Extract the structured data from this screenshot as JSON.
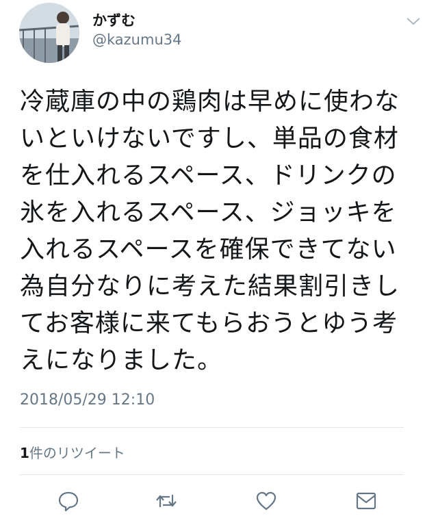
{
  "user": {
    "display_name": "かずむ",
    "handle": "@kazumu34"
  },
  "tweet": {
    "text": "冷蔵庫の中の鶏肉は早めに使わないといけないですし、単品の食材を仕入れるスペース、ドリンクの氷を入れるスペース、ジョッキを入れるスペースを確保できてない為自分なりに考えた結果割引きしてお客様に来てもらおうとゆう考えになりました。",
    "timestamp": "2018/05/29 12:10"
  },
  "stats": {
    "retweet_count": "1",
    "retweet_label": "件のリツイート"
  },
  "icons": {
    "avatar": "avatar",
    "menu": "chevron-down-icon",
    "reply": "reply-icon",
    "retweet": "retweet-icon",
    "like": "heart-icon",
    "message": "envelope-icon"
  },
  "colors": {
    "text": "#14171a",
    "secondary": "#657786",
    "divider": "#e1e8ed"
  }
}
